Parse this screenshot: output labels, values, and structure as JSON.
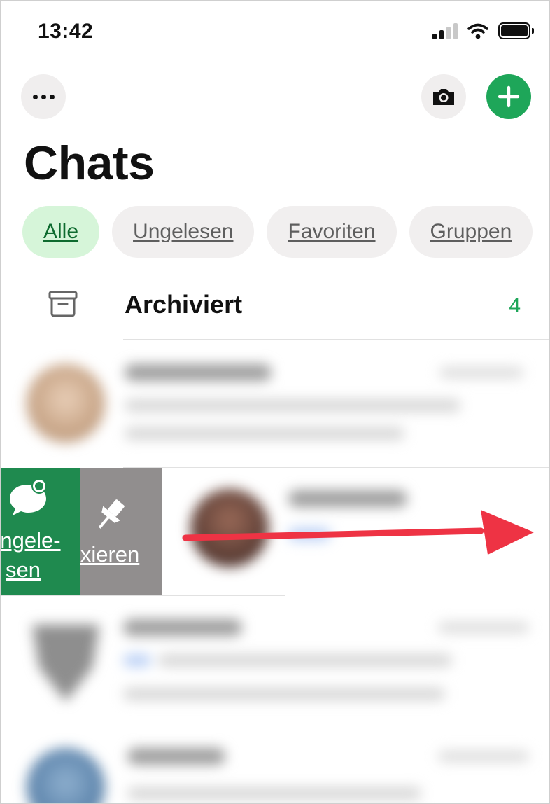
{
  "status_bar": {
    "time": "13:42"
  },
  "header": {
    "title": "Chats"
  },
  "filters": [
    {
      "label": "Alle",
      "active": true
    },
    {
      "label": "Ungelesen",
      "active": false
    },
    {
      "label": "Favoriten",
      "active": false
    },
    {
      "label": "Gruppen",
      "active": false
    }
  ],
  "archived": {
    "label": "Archiviert",
    "count": "4"
  },
  "swipe_actions": {
    "unread_label_line1": "Ungele-",
    "unread_label_line2": "sen",
    "pin_label": "Fixieren"
  },
  "icons": {
    "more": "more-horizontal-icon",
    "camera": "camera-icon",
    "new_chat": "plus-icon",
    "archive": "archive-box-icon",
    "unread": "chat-bubble-unread-icon",
    "pin": "pin-icon",
    "swipe_direction": "arrow-right-icon"
  },
  "colors": {
    "accent_green": "#1ea659",
    "unread_action_bg": "#1f8a4f",
    "pin_action_bg": "#918e8e",
    "active_chip_bg": "#d6f5d9",
    "arrow_red": "#ee3344"
  }
}
